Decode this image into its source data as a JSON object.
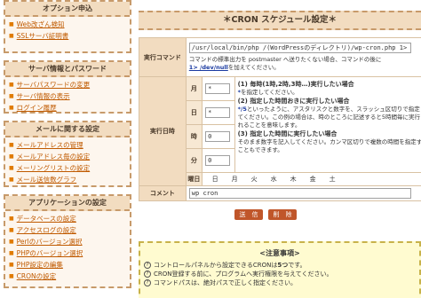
{
  "sidebar": {
    "sections": [
      {
        "title": "オプション申込",
        "items": [
          "Web改ざん検知",
          "SSLサーバ証明書"
        ]
      },
      {
        "title": "サーバ情報とパスワード",
        "items": [
          "サーバパスワードの変更",
          "サーバ情報の表示",
          "ログイン履歴"
        ]
      },
      {
        "title": "メールに関する設定",
        "items": [
          "メールアドレスの管理",
          "メールアドレス毎の設定",
          "メーリングリストの設定",
          "メール送信数グラフ"
        ]
      },
      {
        "title": "アプリケーションの設定",
        "items": [
          "データベースの設定",
          "アクセスログの設定",
          "Perlのバージョン選択",
          "PHPのバージョン選択",
          "PHP設定の編集",
          "CRONの設定"
        ]
      }
    ]
  },
  "main": {
    "title": "＊CRON スケジュール設定＊",
    "command": {
      "label": "実行コマンド",
      "value": "/usr/local/bin/php /(WordPressのディレクトリ)/wp-cron.php 1> /dev/null",
      "note_pre": "コマンドの標準出力を postmaster へ送りたくない場合、コマンドの後に",
      "note_code": "1> /dev/null",
      "note_post": "を加えてください。"
    },
    "schedule": {
      "label": "実行日時",
      "fields": [
        {
          "label": "月",
          "value": "*"
        },
        {
          "label": "日",
          "value": "*"
        },
        {
          "label": "時",
          "value": "0"
        },
        {
          "label": "分",
          "value": "0"
        }
      ],
      "weekday_label": "曜日",
      "weekdays": [
        "日",
        "月",
        "火",
        "水",
        "木",
        "金",
        "土"
      ],
      "guide": {
        "g1_title": "(1) 毎時(1時,2時,3時…)実行したい場合",
        "g1_star": "*",
        "g1_text": "を指定してください。",
        "g2_title": "(2) 指定した時間おきに実行したい場合",
        "g2_code": "*/5",
        "g2_text": "といったように、アスタリスクと数字を、スラッシュ区切りで指定してください。この例の場合は、時のところに記述すると5時間毎に実行されることを意味します。",
        "g3_title": "(3) 指定した時間に実行したい場合",
        "g3_text": "そのまま数字を記入してください。カンマ区切りで複数の時間を指定することもできます。"
      }
    },
    "comment": {
      "label": "コメント",
      "value": "wp cron"
    },
    "buttons": {
      "submit": "送　信",
      "reset": "削　除"
    },
    "notice": {
      "title": "<注意事項>",
      "items": [
        {
          "pre": "コントロールパネルから設定できるCRONは",
          "bold": "5つ",
          "post": "です。"
        },
        {
          "pre": "CRON登録する前に、プログラムへ実行権限を与えてください。",
          "bold": "",
          "post": ""
        },
        {
          "pre": "コマンドパスは、絶対パスで正しく指定ください。",
          "bold": "",
          "post": ""
        }
      ]
    }
  }
}
